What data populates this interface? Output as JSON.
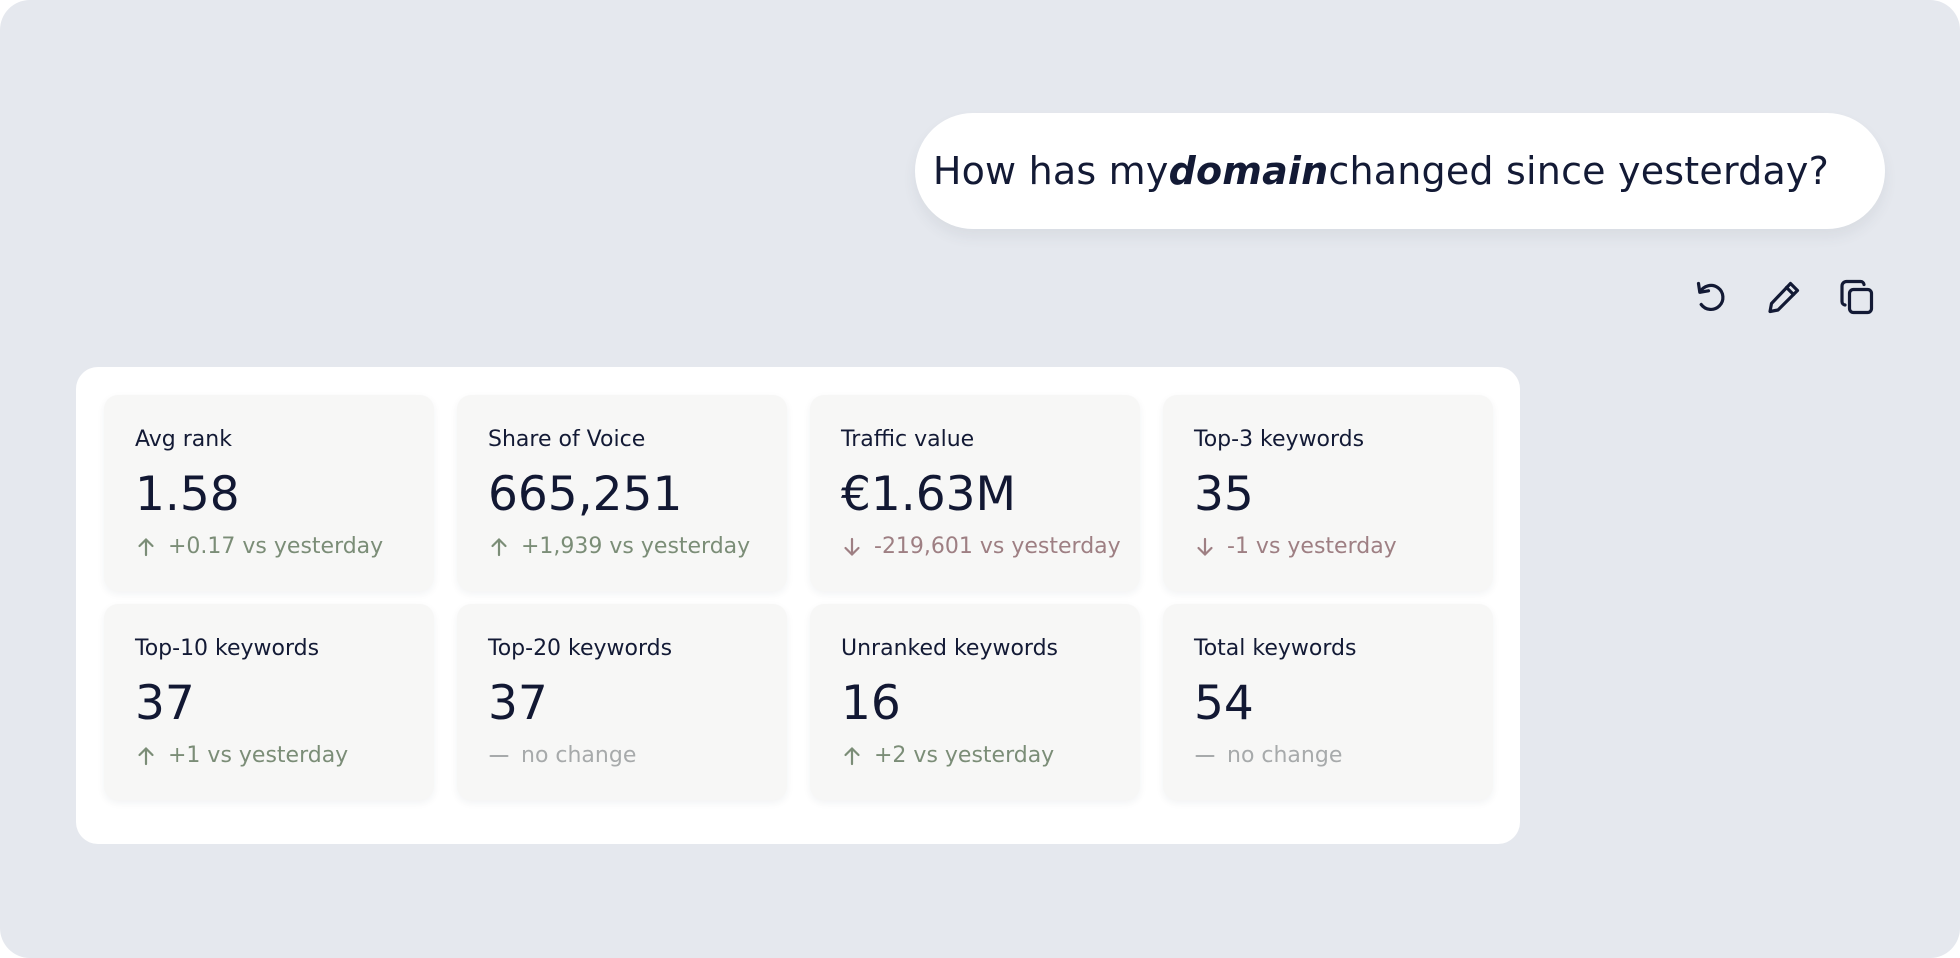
{
  "chat": {
    "user_message": {
      "prefix": "How has my ",
      "emphasis": "domain",
      "suffix": " changed since yesterday?"
    },
    "actions": {
      "regenerate_icon": "refresh-icon",
      "edit_icon": "pencil-icon",
      "copy_icon": "copy-icon"
    }
  },
  "colors": {
    "background": "#e5e8ee",
    "positive": "#7b8d77",
    "negative": "#9e7f83",
    "neutral": "#a7aaab",
    "text": "#131a35"
  },
  "metrics": [
    {
      "label": "Avg rank",
      "value": "1.58",
      "delta": "+0.17 vs yesterday",
      "trend": "up"
    },
    {
      "label": "Share of Voice",
      "value": "665,251",
      "delta": "+1,939 vs yesterday",
      "trend": "up"
    },
    {
      "label": "Traffic value",
      "value": "€1.63M",
      "delta": "-219,601 vs yesterday",
      "trend": "down"
    },
    {
      "label": "Top-3 keywords",
      "value": "35",
      "delta": "-1 vs yesterday",
      "trend": "down"
    },
    {
      "label": "Top-10 keywords",
      "value": "37",
      "delta": "+1 vs yesterday",
      "trend": "up"
    },
    {
      "label": "Top-20 keywords",
      "value": "37",
      "delta": "no change",
      "trend": "none"
    },
    {
      "label": "Unranked keywords",
      "value": "16",
      "delta": "+2 vs yesterday",
      "trend": "up"
    },
    {
      "label": "Total keywords",
      "value": "54",
      "delta": "no change",
      "trend": "none"
    }
  ]
}
